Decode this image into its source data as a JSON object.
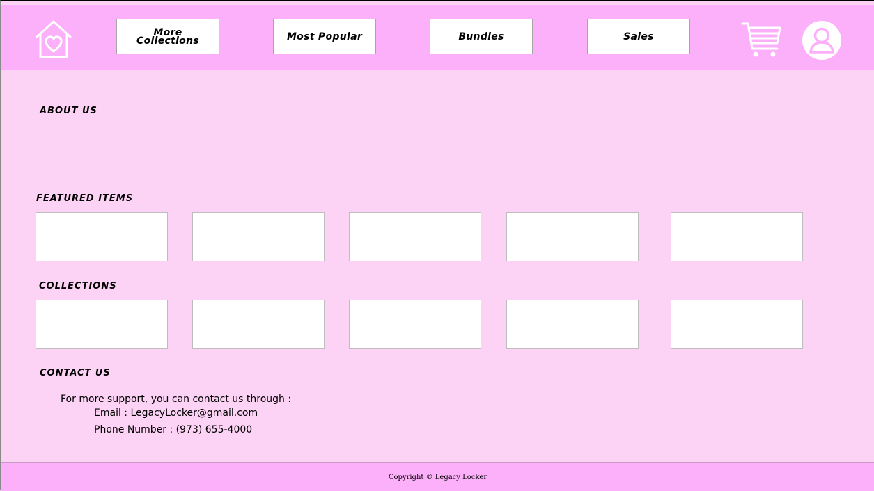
{
  "nav": {
    "more_collections_line1": "More",
    "more_collections_line2": "Collections",
    "most_popular": "Most Popular",
    "bundles": "Bundles",
    "sales": "Sales"
  },
  "icons": {
    "home": "home-heart-icon",
    "cart": "shopping-cart-icon",
    "profile": "user-profile-icon"
  },
  "sections": {
    "about": "ABOUT US",
    "featured": "FEATURED ITEMS",
    "collections": "COLLECTIONS",
    "contact": "CONTACT US"
  },
  "contact": {
    "intro": "For more support, you can contact us through :",
    "email": "Email : LegacyLocker@gmail.com",
    "phone": "Phone Number : (973) 655-4000"
  },
  "footer": {
    "copyright": "Copyright © Legacy Locker"
  },
  "colors": {
    "header_bg": "#fcb0f9",
    "page_bg": "#fcd3f5",
    "tile_bg": "#ffffff"
  }
}
